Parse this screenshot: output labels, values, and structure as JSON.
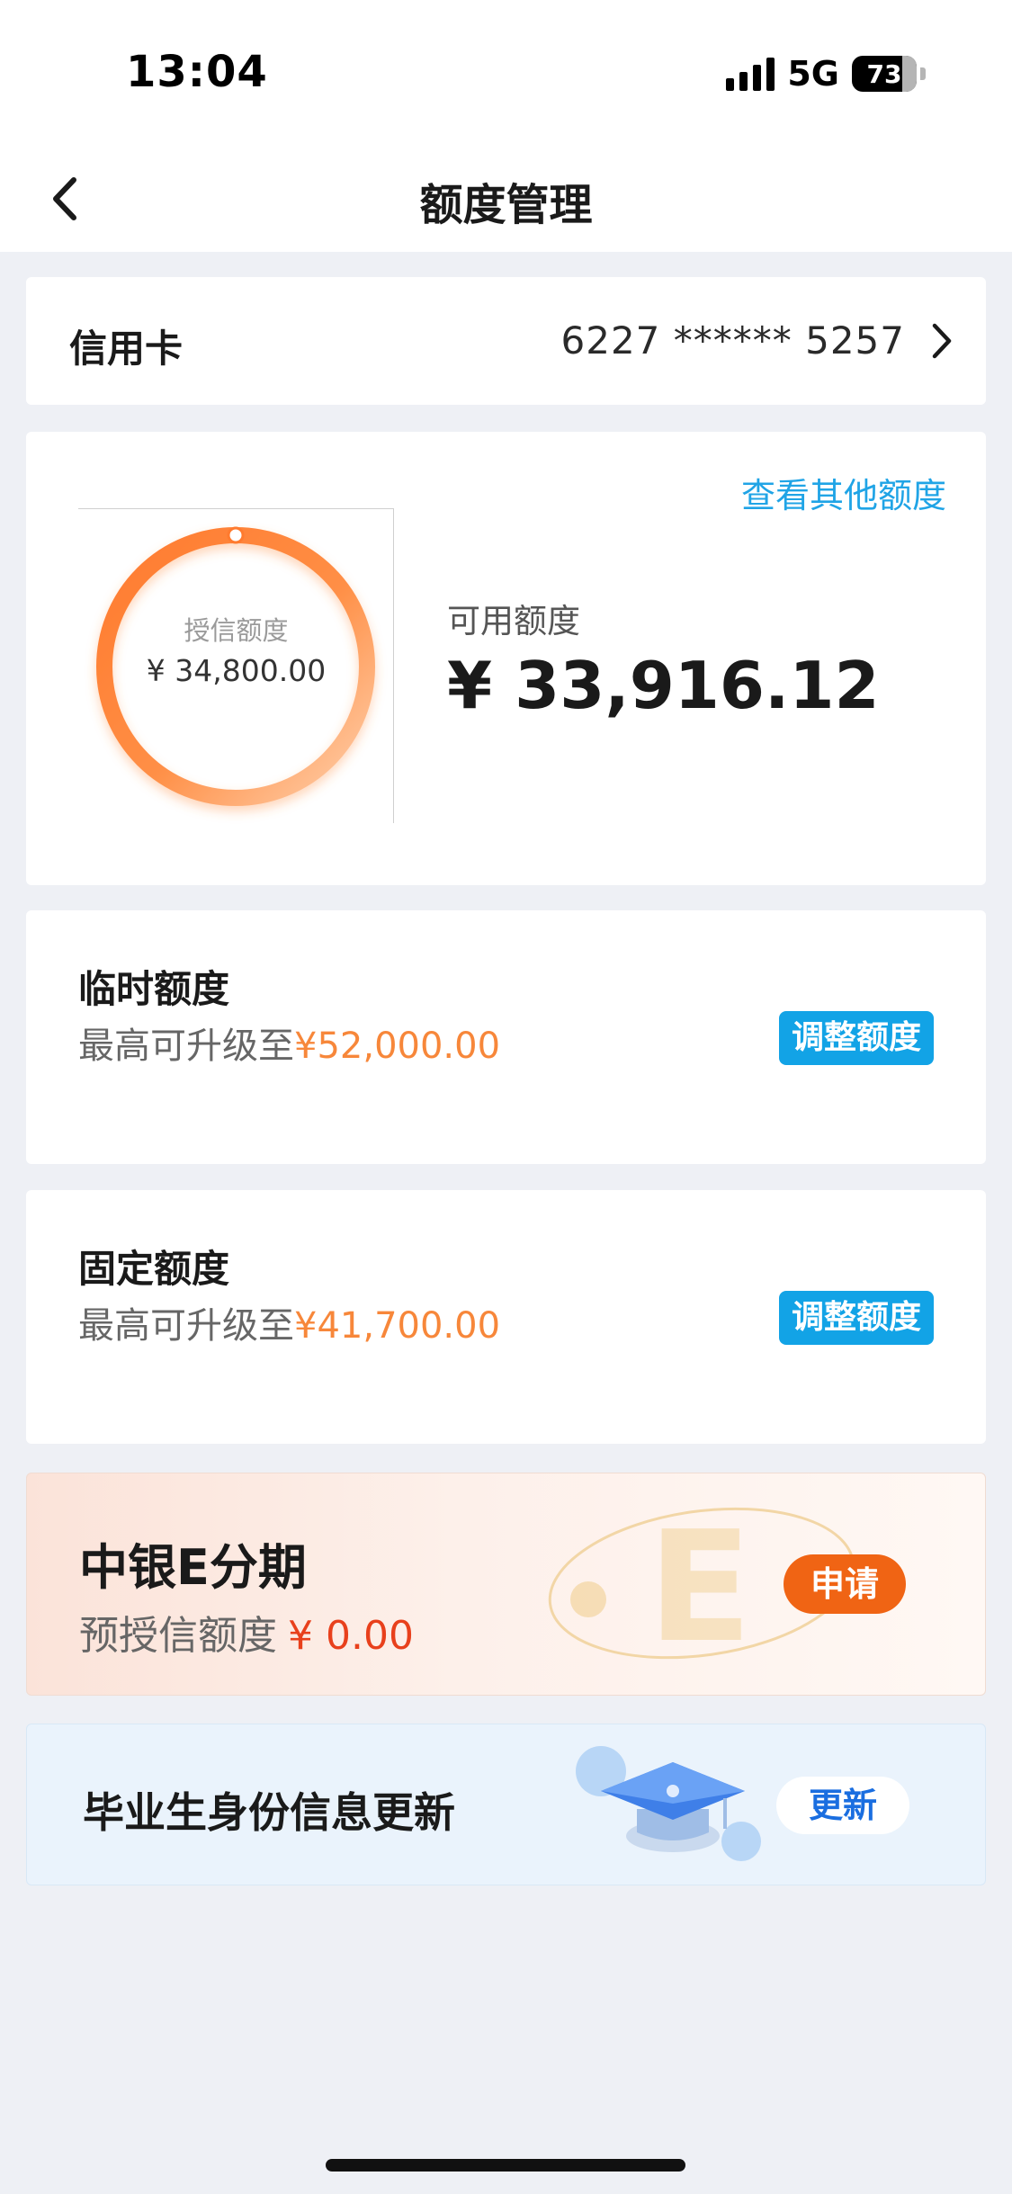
{
  "status_bar": {
    "time": "13:04",
    "network": "5G",
    "battery": "73"
  },
  "header": {
    "title": "额度管理",
    "back_icon": "chevron-left-icon"
  },
  "card_row": {
    "label": "信用卡",
    "card_number": "6227 ****** 5257",
    "chevron_icon": "chevron-right-icon"
  },
  "limit": {
    "other_link": "查看其他额度",
    "credit_label": "授信额度",
    "credit_value": "¥ 34,800.00",
    "available_label": "可用额度",
    "available_value": "¥ 33,916.12",
    "ring_color_start": "#ff7a2e",
    "ring_color_end": "#ffc8a0"
  },
  "temporary": {
    "title": "临时额度",
    "desc_prefix": "最高可升级至",
    "amount": "¥52,000.00",
    "button": "调整额度"
  },
  "fixed": {
    "title": "固定额度",
    "desc_prefix": "最高可升级至",
    "amount": "¥41,700.00",
    "button": "调整额度"
  },
  "installment": {
    "title": "中银E分期",
    "desc_prefix": "预授信额度",
    "amount": "¥ 0.00",
    "button": "申请"
  },
  "graduate": {
    "title": "毕业生身份信息更新",
    "button": "更新",
    "icon": "graduation-cap-icon"
  },
  "colors": {
    "accent_blue": "#12a3e6",
    "link_blue": "#20a4e6",
    "orange_amount": "#f7873a",
    "apply_orange": "#f06414",
    "red_amount": "#e8401c"
  }
}
